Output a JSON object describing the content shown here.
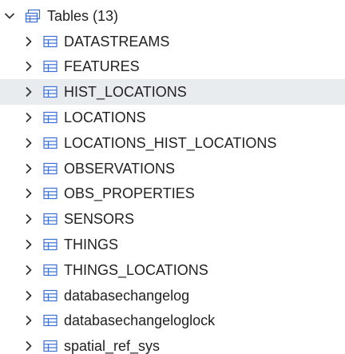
{
  "tree": {
    "group": {
      "label": "Tables (13)",
      "icon": "tables-folder-icon",
      "expanded": true
    },
    "tables": [
      {
        "label": "DATASTREAMS",
        "icon": "table-icon",
        "selected": false
      },
      {
        "label": "FEATURES",
        "icon": "table-icon",
        "selected": false
      },
      {
        "label": "HIST_LOCATIONS",
        "icon": "table-icon",
        "selected": true
      },
      {
        "label": "LOCATIONS",
        "icon": "table-icon",
        "selected": false
      },
      {
        "label": "LOCATIONS_HIST_LOCATIONS",
        "icon": "table-icon",
        "selected": false
      },
      {
        "label": "OBSERVATIONS",
        "icon": "table-icon",
        "selected": false
      },
      {
        "label": "OBS_PROPERTIES",
        "icon": "table-icon",
        "selected": false
      },
      {
        "label": "SENSORS",
        "icon": "table-icon",
        "selected": false
      },
      {
        "label": "THINGS",
        "icon": "table-icon",
        "selected": false
      },
      {
        "label": "THINGS_LOCATIONS",
        "icon": "table-icon",
        "selected": false
      },
      {
        "label": "databasechangelog",
        "icon": "table-icon",
        "selected": false
      },
      {
        "label": "databasechangeloglock",
        "icon": "table-icon",
        "selected": false
      },
      {
        "label": "spatial_ref_sys",
        "icon": "table-icon",
        "selected": false
      }
    ]
  },
  "colors": {
    "icon_stroke": "#3b6fd4",
    "chevron": "#333333",
    "selected_bg": "#e9ecef",
    "text": "#222222"
  }
}
